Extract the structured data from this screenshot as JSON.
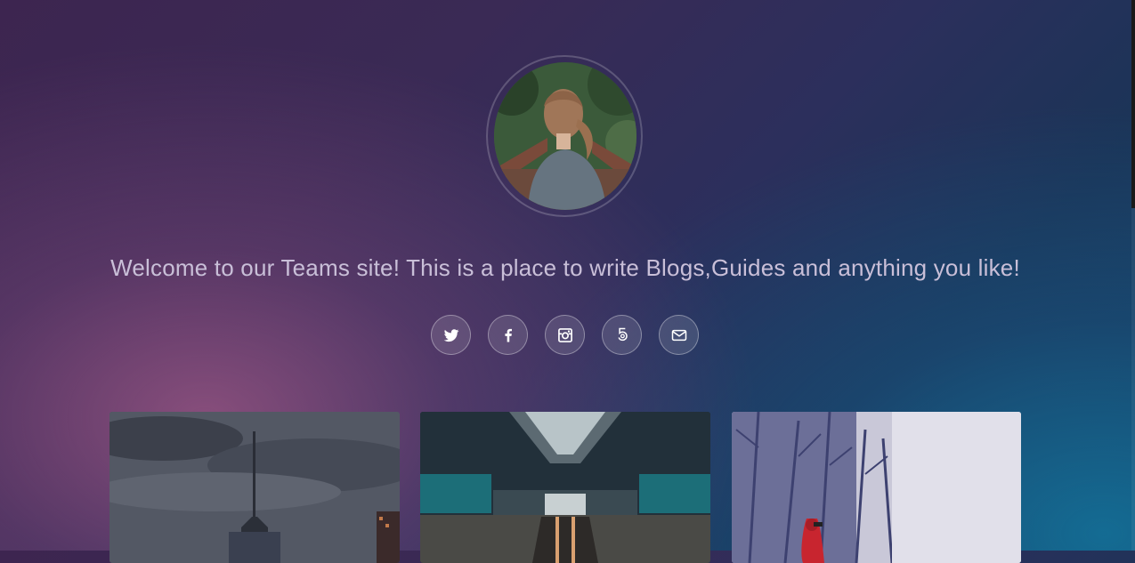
{
  "hero": {
    "avatar_alt": "Profile photo of a woman on a bridge in a forest",
    "tagline": "Welcome to our Teams site! This is a place to write Blogs,Guides and anything you like!"
  },
  "socials": [
    {
      "name": "twitter",
      "icon": "twitter-icon"
    },
    {
      "name": "facebook",
      "icon": "facebook-icon"
    },
    {
      "name": "instagram",
      "icon": "instagram-icon"
    },
    {
      "name": "500px",
      "icon": "500px-icon"
    },
    {
      "name": "email",
      "icon": "envelope-icon"
    }
  ],
  "cards": [
    {
      "image": "city-skyline-tower-image"
    },
    {
      "image": "station-escalator-image"
    },
    {
      "image": "snowy-forest-red-coat-image"
    }
  ],
  "colors": {
    "bg_top_left": "#3d2550",
    "bg_bottom_left": "#8e5480",
    "bg_bottom_right": "#146e96",
    "text": "#c9bfd8"
  }
}
